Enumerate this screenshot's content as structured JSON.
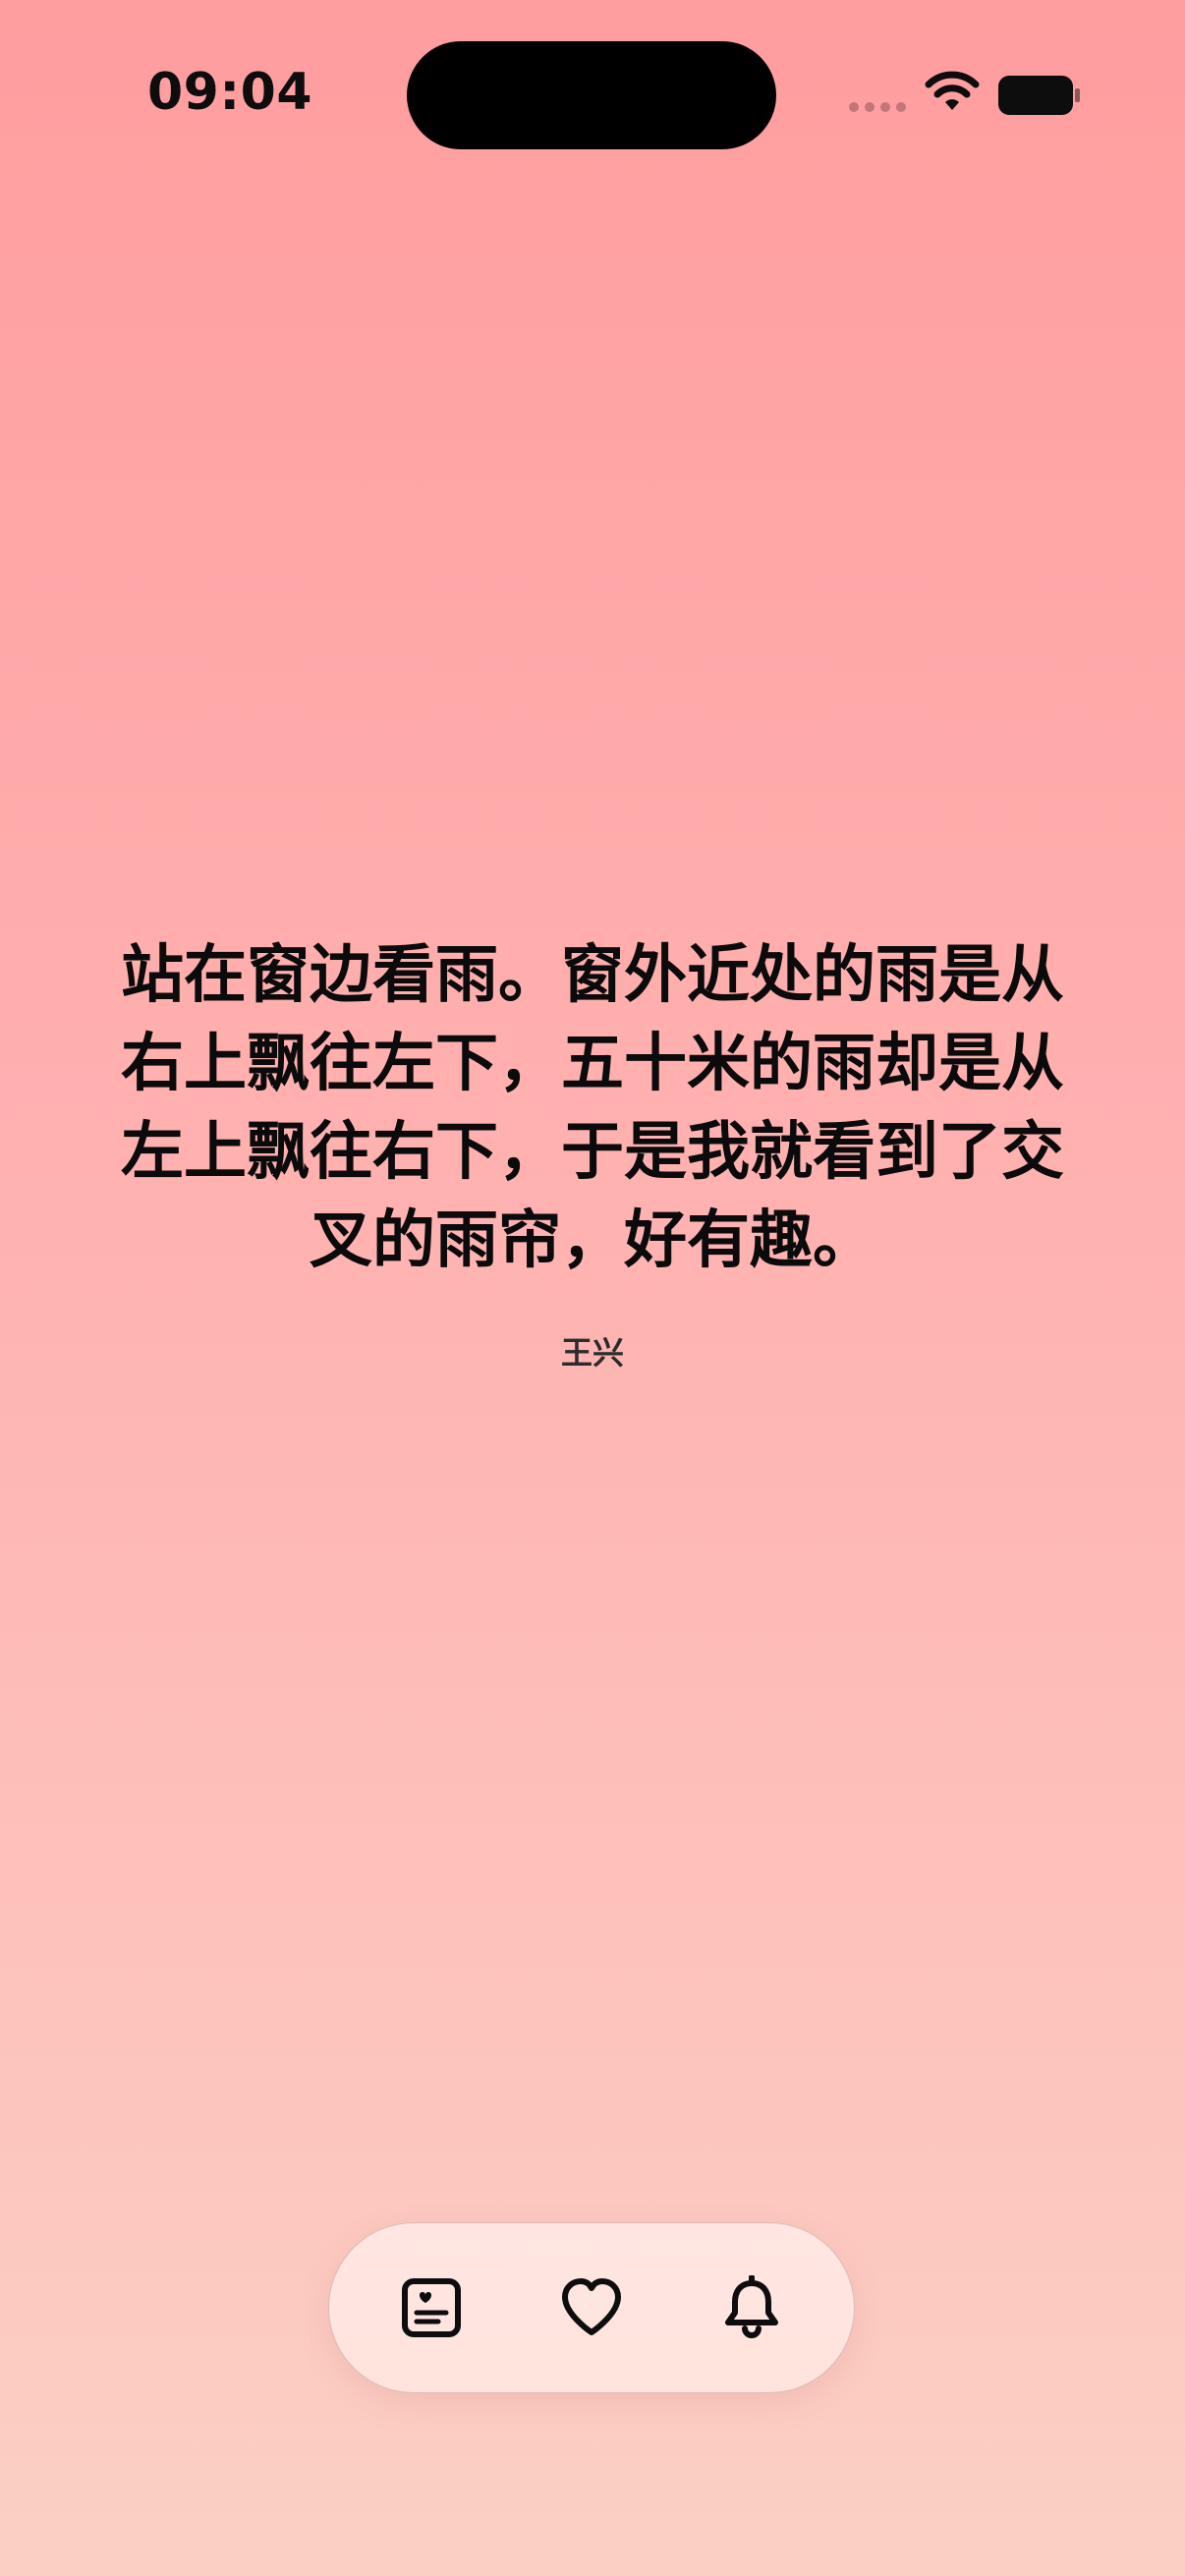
{
  "status_bar": {
    "time": "09:04"
  },
  "quote": {
    "text": "站在窗边看雨。窗外近处的雨是从右上飘往左下，五十米的雨却是从左上飘往右下，于是我就看到了交叉的雨帘，好有趣。",
    "author": "王兴"
  },
  "tabbar": {
    "items": [
      {
        "icon": "journal-heart-icon"
      },
      {
        "icon": "heart-icon"
      },
      {
        "icon": "bell-icon"
      }
    ]
  },
  "colors": {
    "background_top": "#ff9d9f",
    "background_bottom": "#fbd0c4",
    "text": "#0b0b0b",
    "tabbar_bg": "#ffe4de"
  }
}
